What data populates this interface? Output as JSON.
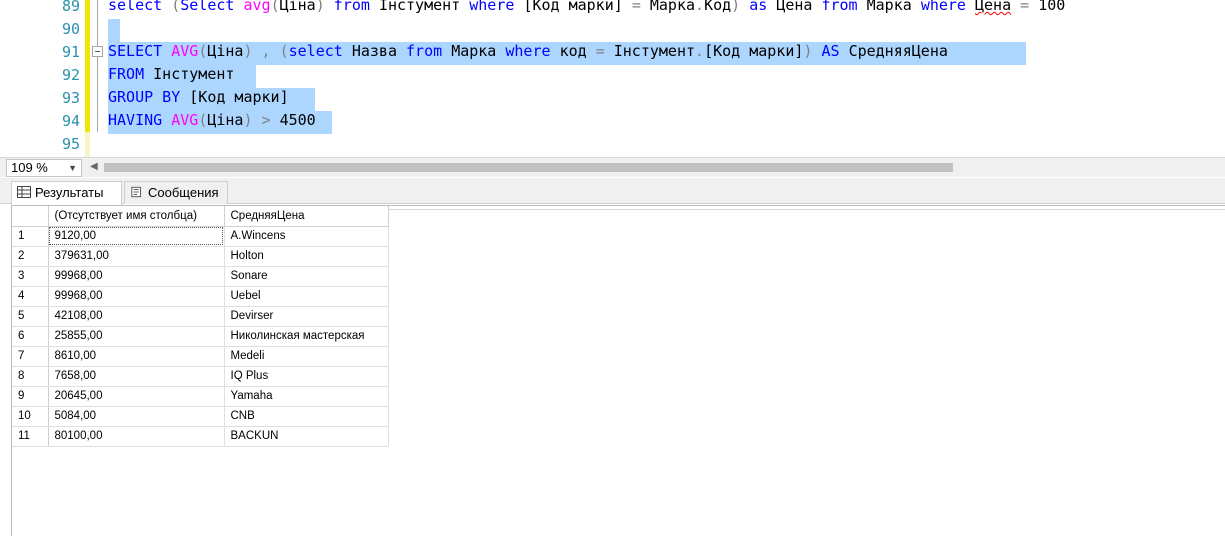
{
  "editor": {
    "lines": [
      {
        "num": "89"
      },
      {
        "num": "90"
      },
      {
        "num": "91"
      },
      {
        "num": "92"
      },
      {
        "num": "93"
      },
      {
        "num": "94"
      },
      {
        "num": "95"
      }
    ],
    "line89": {
      "t1": "select ",
      "t2": "(",
      "t3": "Select ",
      "t4": "avg",
      "t5": "(",
      "t6": "Ціна",
      "t7": ")",
      "t8": " from ",
      "t9": "Інстумент ",
      "t10": "where ",
      "t11": "[Код марки] ",
      "t12": "=",
      "t13": " Марка",
      "t14": ".",
      "t15": "Код",
      "t16": ")",
      "t17": " as ",
      "t18": "Цена ",
      "t19": "from ",
      "t20": "Марка ",
      "t21": "where ",
      "t22": "Цена",
      "t23": " = ",
      "t24": "100"
    },
    "line91": {
      "t1": "SELECT ",
      "t2": "AVG",
      "t3": "(",
      "t4": "Ціна",
      "t5": ") , (",
      "t6": "select ",
      "t7": "Назва ",
      "t8": "from ",
      "t9": "Марка ",
      "t10": "where ",
      "t11": "код ",
      "t12": "=",
      "t13": " Інстумент",
      "t14": ".",
      "t15": "[Код марки]",
      "t16": ") ",
      "t17": "AS ",
      "t18": "СредняяЦена"
    },
    "line92": {
      "t1": "FROM ",
      "t2": "Інстумент"
    },
    "line93": {
      "t1": "GROUP BY ",
      "t2": "[Код марки]"
    },
    "line94": {
      "t1": "HAVING ",
      "t2": "AVG",
      "t3": "(",
      "t4": "Ціна",
      "t5": ") > ",
      "t6": "4500"
    }
  },
  "zoom": {
    "value": "109 %"
  },
  "tabs": [
    {
      "label": "Результаты"
    },
    {
      "label": "Сообщения"
    }
  ],
  "grid": {
    "headers": [
      "",
      "(Отсутствует имя столбца)",
      "СредняяЦена"
    ],
    "rows": [
      [
        "1",
        "9120,00",
        "A.Wincens"
      ],
      [
        "2",
        "379631,00",
        "Holton"
      ],
      [
        "3",
        "99968,00",
        "Sonare"
      ],
      [
        "4",
        "99968,00",
        "Uebel"
      ],
      [
        "5",
        "42108,00",
        "Devirser"
      ],
      [
        "6",
        "25855,00",
        "Николинская мастерская"
      ],
      [
        "7",
        "8610,00",
        "Medeli"
      ],
      [
        "8",
        "7658,00",
        "IQ Plus"
      ],
      [
        "9",
        "20645,00",
        "Yamaha"
      ],
      [
        "10",
        "5084,00",
        "CNB"
      ],
      [
        "11",
        "80100,00",
        "BACKUN"
      ]
    ]
  },
  "colors": {
    "keyword": "#0000ff",
    "function": "#ff00ff",
    "operator": "#808080",
    "line_number": "#2b91af",
    "selection": "#add6ff"
  },
  "icons": {
    "results_tab": "grid-icon",
    "messages_tab": "message-icon"
  }
}
